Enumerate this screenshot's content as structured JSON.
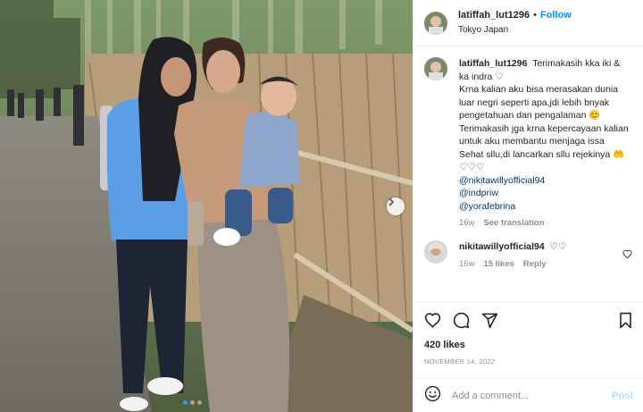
{
  "post": {
    "username": "latiffah_lut1296",
    "separator": "•",
    "follow_label": "Follow",
    "location": "Tokyo Japan"
  },
  "caption": {
    "username": "latiffah_lut1296",
    "line1": "Terimakasih kka iki & ka indra ♡",
    "line2": "Krna kalian aku bisa merasakan dunia luar negri seperti apa,jdi lebih bnyak pengetahuan dan pengalaman 😊",
    "line3": "Terimakasih jga krna kepercayaan kalian untuk aku membantu menjaga issa",
    "line4": "Sehat sllu,di lancarkan sllu rejekinya 🤲",
    "line5": "♡♡♡",
    "mentions": [
      "@nikitawillyofficial94",
      "@indpriw",
      "@yorafebrina"
    ],
    "time": "16w",
    "see_translation": "See translation"
  },
  "comment": {
    "username": "nikitawillyofficial94",
    "text": "♡♡",
    "time": "16w",
    "likes": "15 likes",
    "reply": "Reply"
  },
  "stats": {
    "likes": "420 likes",
    "date": "NOVEMBER 14, 2022"
  },
  "composer": {
    "placeholder": "Add a comment...",
    "post_label": "Post"
  },
  "icons": {
    "like": "heart-icon",
    "comment": "comment-icon",
    "share": "share-icon",
    "save": "bookmark-icon",
    "emoji": "emoji-icon",
    "next": "chevron-right-icon"
  },
  "colors": {
    "accent": "#0095f6",
    "post_disabled": "#b2dffc",
    "link": "#00376b",
    "muted": "#8e8e8e"
  },
  "carousel": {
    "count": 3,
    "active": 1
  }
}
